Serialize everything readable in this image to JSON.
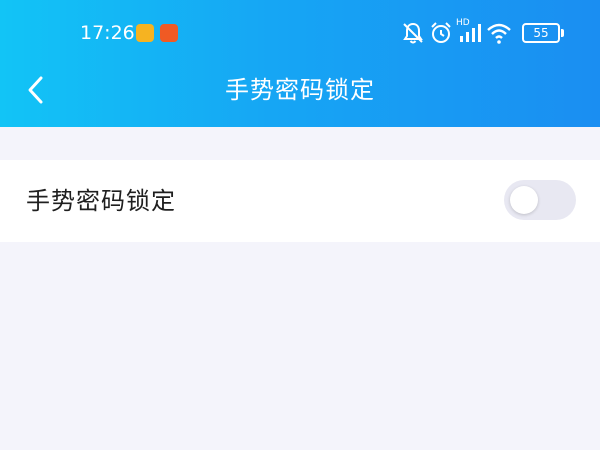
{
  "status_bar": {
    "time": "17:26",
    "battery": "55",
    "network_label": "HD",
    "icons": [
      "files-app-icon",
      "video-app-icon",
      "mute-bell-icon",
      "alarm-icon",
      "signal-icon",
      "wifi-icon",
      "battery-icon"
    ]
  },
  "nav": {
    "title": "手势密码锁定",
    "back_icon": "chevron-left-icon"
  },
  "settings": {
    "gesture_lock": {
      "label": "手势密码锁定",
      "enabled": false
    }
  },
  "colors": {
    "header_start": "#12c4f6",
    "header_end": "#1a8ef2",
    "page_bg": "#f4f4fb",
    "toggle_off": "#e8e8f2"
  }
}
